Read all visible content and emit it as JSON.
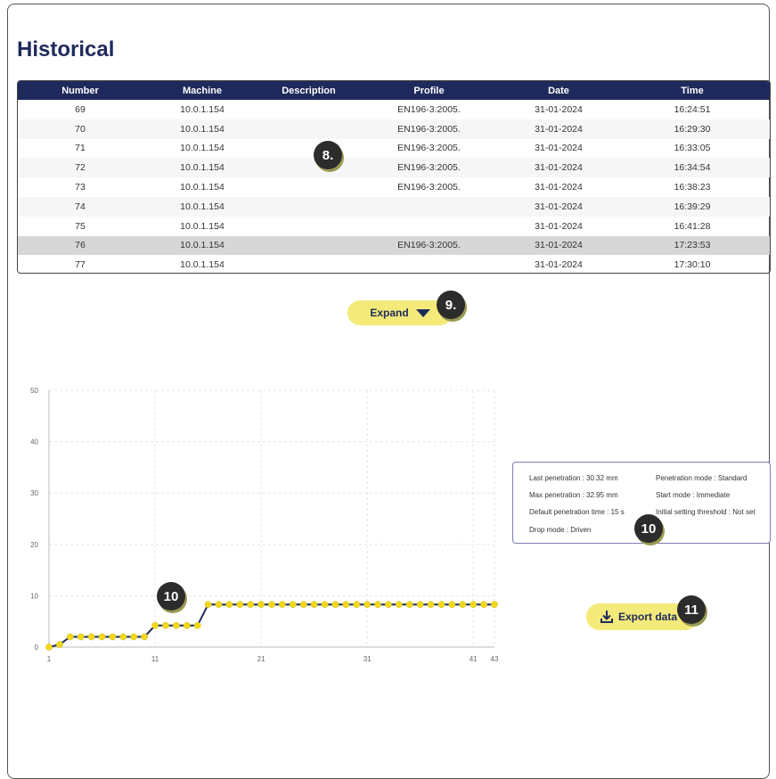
{
  "page": {
    "title": "Historical"
  },
  "table": {
    "headers": [
      "Number",
      "Machine",
      "Description",
      "Profile",
      "Date",
      "Time"
    ],
    "rows": [
      [
        "69",
        "10.0.1.154",
        "",
        "EN196-3:2005.",
        "31-01-2024",
        "16:24:51"
      ],
      [
        "70",
        "10.0.1.154",
        "",
        "EN196-3:2005.",
        "31-01-2024",
        "16:29:30"
      ],
      [
        "71",
        "10.0.1.154",
        "",
        "EN196-3:2005.",
        "31-01-2024",
        "16:33:05"
      ],
      [
        "72",
        "10.0.1.154",
        "",
        "EN196-3:2005.",
        "31-01-2024",
        "16:34:54"
      ],
      [
        "73",
        "10.0.1.154",
        "",
        "EN196-3:2005.",
        "31-01-2024",
        "16:38:23"
      ],
      [
        "74",
        "10.0.1.154",
        "",
        "",
        "31-01-2024",
        "16:39:29"
      ],
      [
        "75",
        "10.0.1.154",
        "",
        "",
        "31-01-2024",
        "16:41:28"
      ],
      [
        "76",
        "10.0.1.154",
        "",
        "EN196-3:2005.",
        "31-01-2024",
        "17:23:53"
      ],
      [
        "77",
        "10.0.1.154",
        "",
        "",
        "31-01-2024",
        "17:30:10"
      ]
    ],
    "selected_row": 7
  },
  "expand_button": {
    "label": "Expand"
  },
  "info": {
    "last_penetration": "Last penetration : 30.32 mm",
    "penetration_mode": "Penetration mode : Standard",
    "max_penetration": "Max penetration : 32.95 mm",
    "start_mode": "Start mode : Immediate",
    "default_time": "Default penetration time : 15 s",
    "threshold": "Initial setting threshold : Not set",
    "drop_mode": "Drop mode : Driven"
  },
  "export_button": {
    "label": "Export data"
  },
  "callouts": {
    "c8": "8.",
    "c9": "9.",
    "c10a": "10",
    "c10b": "10",
    "c11": "11"
  },
  "colors": {
    "header": "#1f2a5c",
    "accent_yellow": "#f4ea7a",
    "point": "#f2d81b",
    "line": "#1f2a5c"
  },
  "chart_data": {
    "type": "line",
    "x": [
      1,
      2,
      3,
      4,
      5,
      6,
      7,
      8,
      9,
      10,
      11,
      12,
      13,
      14,
      15,
      16,
      17,
      18,
      19,
      20,
      21,
      22,
      23,
      24,
      25,
      26,
      27,
      28,
      29,
      30,
      31,
      32,
      33,
      34,
      35,
      36,
      37,
      38,
      39,
      40,
      41,
      42,
      43
    ],
    "y": [
      0,
      0.5,
      2,
      2,
      2,
      2,
      2,
      2,
      2,
      2,
      4.2,
      4.2,
      4.2,
      4.2,
      4.2,
      8.3,
      8.3,
      8.3,
      8.3,
      8.3,
      8.3,
      8.3,
      8.3,
      8.3,
      8.3,
      8.3,
      8.3,
      8.3,
      8.3,
      8.3,
      8.3,
      8.3,
      8.3,
      8.3,
      8.3,
      8.3,
      8.3,
      8.3,
      8.3,
      8.3,
      8.3,
      8.3,
      8.3
    ],
    "xticks": [
      1,
      11,
      21,
      31,
      41,
      43
    ],
    "yticks": [
      0,
      10,
      20,
      30,
      40,
      50
    ],
    "xlim": [
      1,
      43
    ],
    "ylim": [
      0,
      50
    ],
    "grid": true
  }
}
